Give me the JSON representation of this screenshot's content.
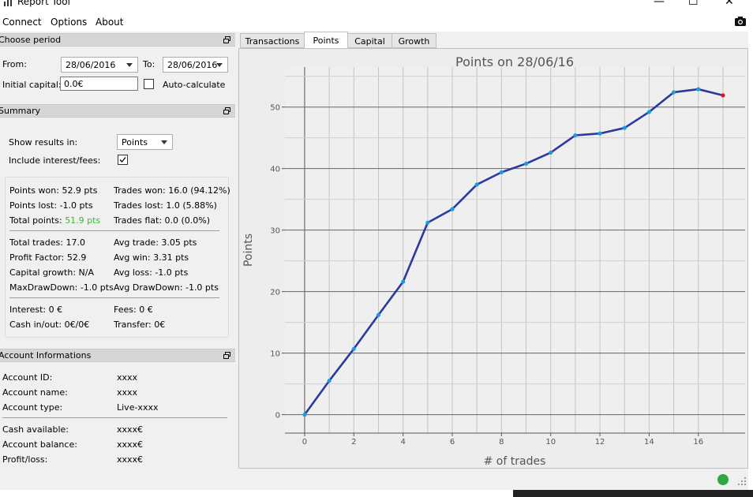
{
  "window": {
    "title": "Report Tool",
    "minimize": "—",
    "maximize": "☐",
    "close": "✕"
  },
  "menu": {
    "items": [
      "Connect",
      "Options",
      "About"
    ]
  },
  "period": {
    "header": "Choose period",
    "from_label": "From:",
    "from_value": "28/06/2016",
    "to_label": "To:",
    "to_value": "28/06/2016",
    "capital_label": "Initial capital:",
    "capital_value": "0.0€",
    "auto_label": "Auto-calculate",
    "auto_checked": false
  },
  "summary": {
    "header": "Summary",
    "show_label": "Show results in:",
    "show_value": "Points",
    "fees_label": "Include interest/fees:",
    "fees_checked": true,
    "points_won": "Points won: 52.9 pts",
    "points_lost": "Points lost: -1.0 pts",
    "total_points_label": "Total points:",
    "total_points_value": "51.9 pts",
    "trades_won": "Trades won: 16.0 (94.12%)",
    "trades_lost": "Trades lost: 1.0 (5.88%)",
    "trades_flat": "Trades flat: 0.0 (0.0%)",
    "total_trades": "Total trades: 17.0",
    "profit_factor": "Profit Factor: 52.9",
    "capital_growth": "Capital growth: N/A",
    "max_drawdown": "MaxDrawDown: -1.0 pts",
    "avg_trade": "Avg trade: 3.05 pts",
    "avg_win": "Avg win: 3.31 pts",
    "avg_loss": "Avg loss: -1.0 pts",
    "avg_drawdown": "Avg DrawDown: -1.0 pts",
    "interest": "Interest: 0 €",
    "cash": "Cash in/out: 0€/0€",
    "fees": "Fees: 0 €",
    "transfer": "Transfer: 0€"
  },
  "account": {
    "header": "Account Informations",
    "rows": [
      {
        "label": "Account ID:",
        "value": "xxxx"
      },
      {
        "label": "Account name:",
        "value": "xxxx"
      },
      {
        "label": "Account type:",
        "value": "Live-xxxx"
      },
      {
        "label": "Cash available:",
        "value": "xxxx€"
      },
      {
        "label": "Account balance:",
        "value": "xxxx€"
      },
      {
        "label": "Profit/loss:",
        "value": "xxxx€"
      }
    ]
  },
  "tabs": [
    "Transactions",
    "Points",
    "Capital",
    "Growth"
  ],
  "active_tab": "Points",
  "colors": {
    "positive": "#3ab63a",
    "line": "#2b3a9c",
    "marker": "#1a9ce0",
    "last_marker": "#e0141e",
    "status_ok": "#2da842"
  },
  "icons": {
    "camera": "camera-icon",
    "restore": "restore-window-icon",
    "app": "chart-app-icon"
  },
  "chart_data": {
    "type": "line",
    "title": "Points on 28/06/16",
    "xlabel": "# of trades",
    "ylabel": "Points",
    "xlim": [
      -0.8,
      17.9
    ],
    "ylim": [
      -3,
      56.5
    ],
    "xticks": [
      0,
      2,
      4,
      6,
      8,
      10,
      12,
      14,
      16
    ],
    "yticks": [
      0,
      10,
      20,
      30,
      40,
      50
    ],
    "grid": true,
    "x": [
      0,
      1,
      2,
      3,
      4,
      5,
      6,
      7,
      8,
      9,
      10,
      11,
      12,
      13,
      14,
      15,
      16,
      17
    ],
    "y": [
      0,
      5.5,
      10.7,
      16.2,
      21.6,
      31.2,
      33.4,
      37.4,
      39.4,
      40.8,
      42.6,
      45.4,
      45.7,
      46.6,
      49.2,
      52.4,
      52.9,
      51.9
    ]
  }
}
